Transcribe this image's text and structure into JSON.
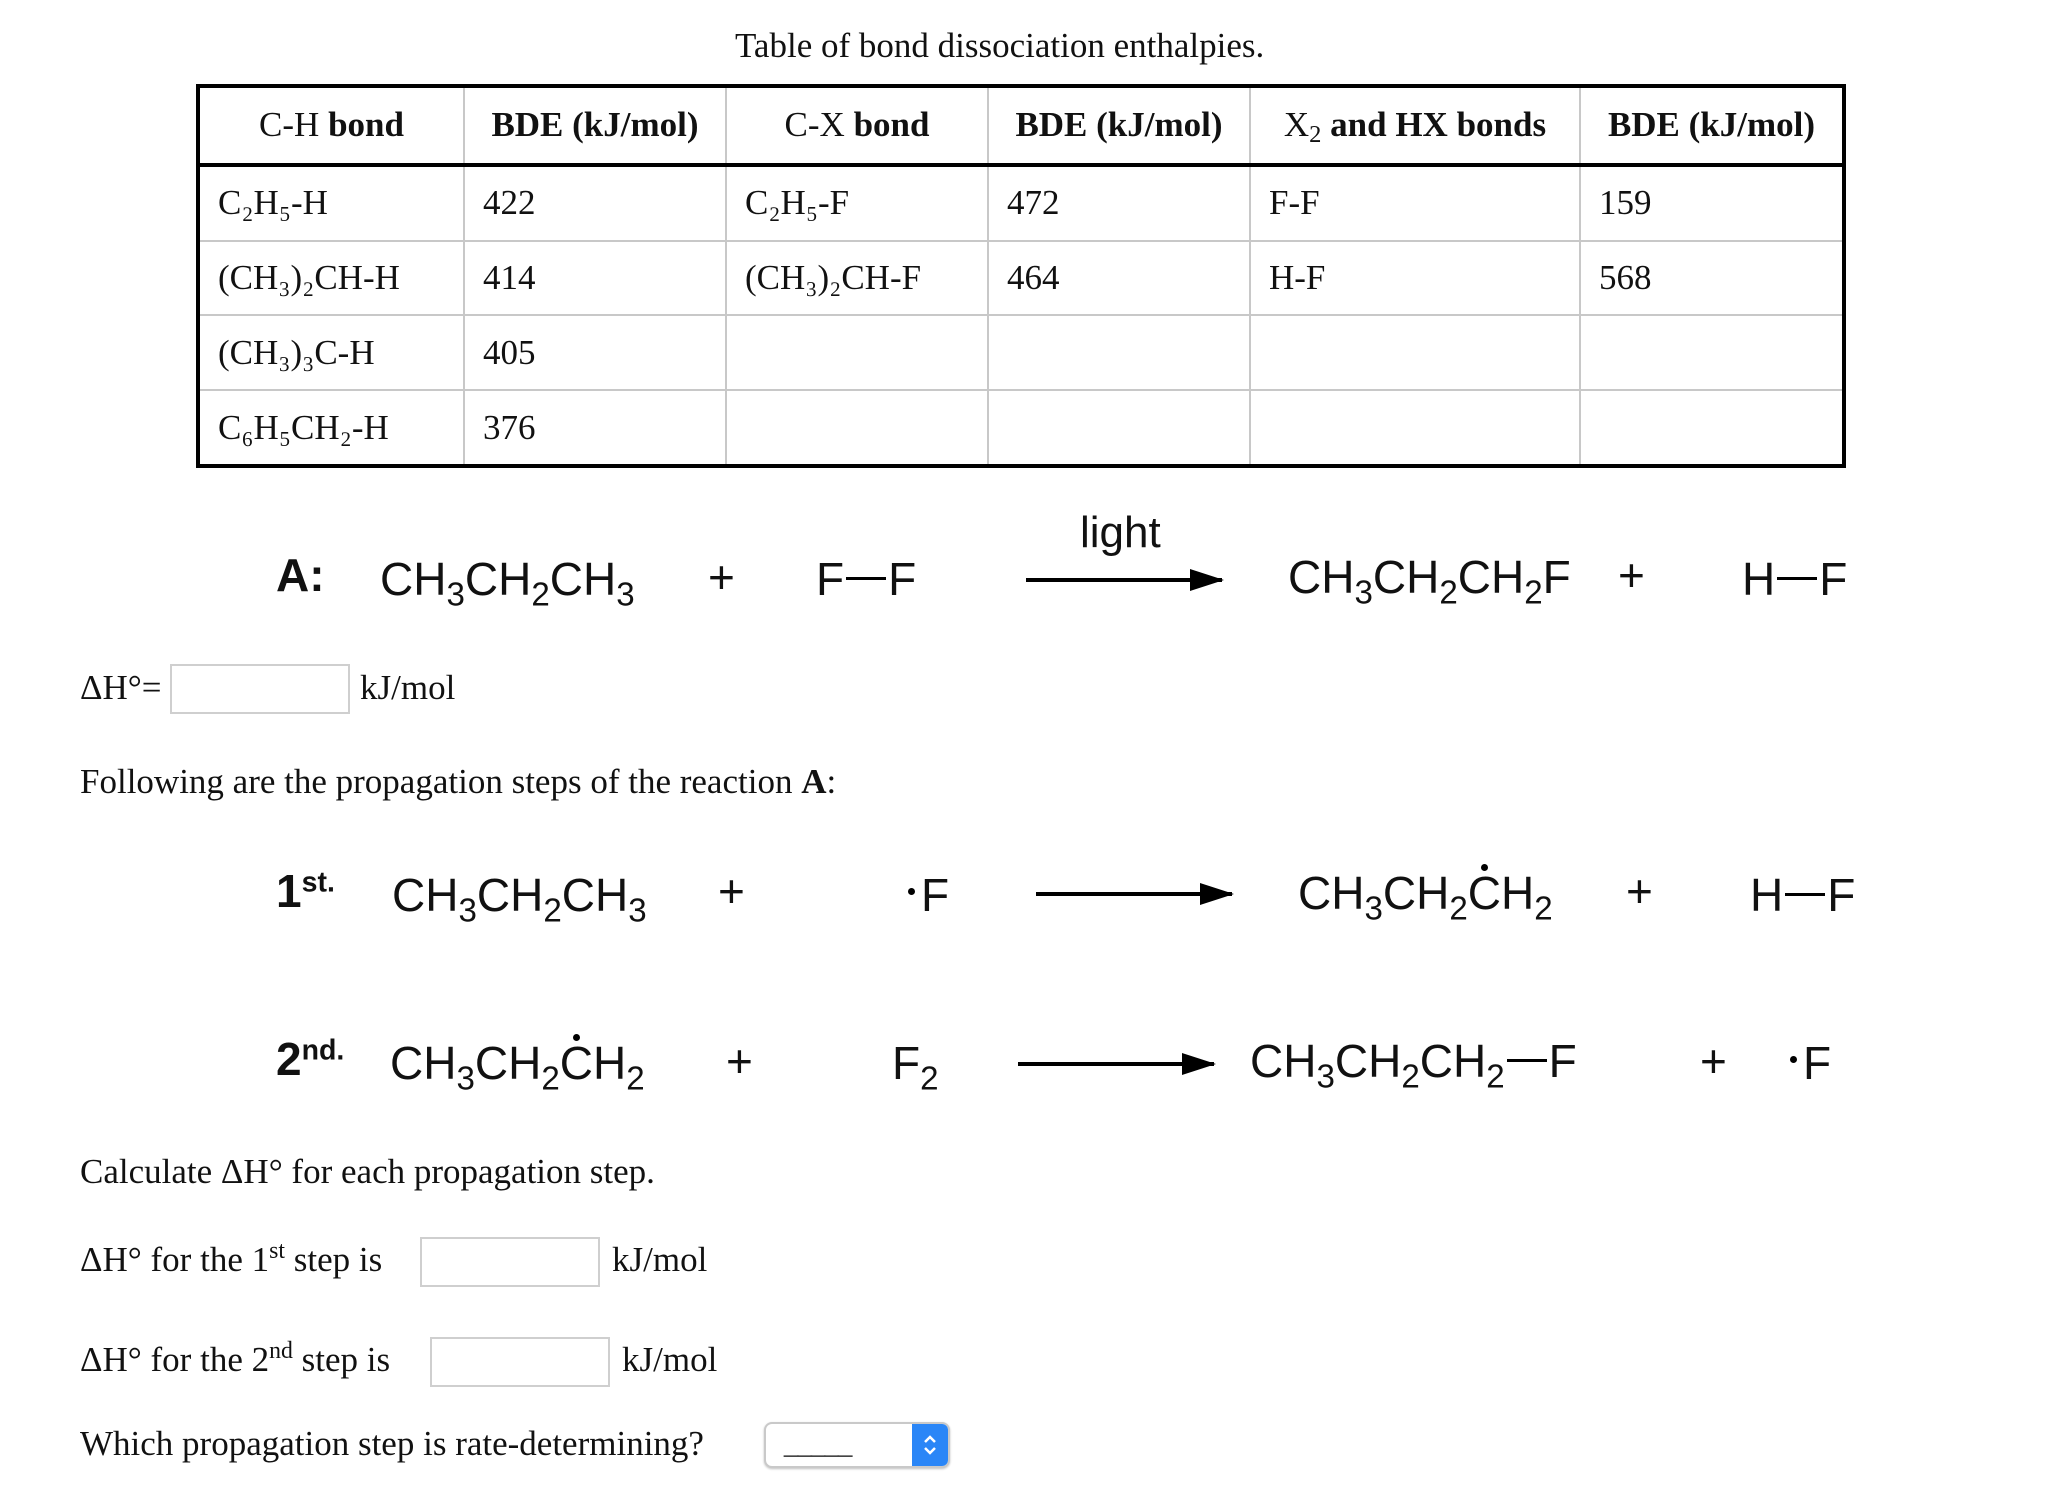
{
  "table": {
    "caption": "Table of bond dissociation enthalpies.",
    "headers": [
      {
        "main": "C-H",
        "rest": "bond"
      },
      {
        "main": "BDE (kJ/mol)",
        "rest": ""
      },
      {
        "main": "C-X",
        "rest": "bond"
      },
      {
        "main": "BDE (kJ/mol)",
        "rest": ""
      },
      {
        "main": "X",
        "sub": "2",
        "rest": "and HX bonds"
      },
      {
        "main": "BDE (kJ/mol)",
        "rest": ""
      }
    ],
    "rows": [
      {
        "ch_bond": "C₂H₅-H",
        "ch_bde": "422",
        "cx_bond": "C₂H₅-F",
        "cx_bde": "472",
        "x_bond": "F-F",
        "x_bde": "159"
      },
      {
        "ch_bond": "(CH₃)₂CH-H",
        "ch_bde": "414",
        "cx_bond": "(CH₃)₂CH-F",
        "cx_bde": "464",
        "x_bond": "H-F",
        "x_bde": "568"
      },
      {
        "ch_bond": "(CH₃)₃C-H",
        "ch_bde": "405",
        "cx_bond": "",
        "cx_bde": "",
        "x_bond": "",
        "x_bde": ""
      },
      {
        "ch_bond": "C₆H₅CH₂-H",
        "ch_bde": "376",
        "cx_bond": "",
        "cx_bde": "",
        "x_bond": "",
        "x_bde": ""
      }
    ]
  },
  "reaction_a": {
    "label": "A:",
    "reactant1": "CH3CH2CH3",
    "plus": "+",
    "reactant2": "F—F",
    "condition": "light",
    "product1": "CH3CH2CH2F",
    "product2": "H—F"
  },
  "delta_h_overall": {
    "label": "ΔH°=",
    "value": "",
    "unit": "kJ/mol"
  },
  "propagation_intro": {
    "text": "Following are the propagation steps of the reaction ",
    "bold": "A",
    "end": ":"
  },
  "step1": {
    "num": "1",
    "sup": "st.",
    "colon": ":",
    "reactant1": "CH3CH2CH3",
    "plus": "+",
    "reactant2": "•F",
    "product1": "CH3CH2ĊH2",
    "product2": "H—F"
  },
  "step2": {
    "num": "2",
    "sup": "nd.",
    "colon": ":",
    "reactant1": "CH3CH2ĊH2",
    "plus": "+",
    "reactant2": "F2",
    "product1": "CH3CH2CH2—F",
    "product2": "•F"
  },
  "calc_prompt": "Calculate ΔH° for each propagation step.",
  "step1_answer": {
    "prefix": "ΔH° for the 1",
    "sup": "st",
    "suffix": " step is",
    "value": "",
    "unit": "kJ/mol"
  },
  "step2_answer": {
    "prefix": "ΔH° for the 2",
    "sup": "nd",
    "suffix": " step is",
    "value": "",
    "unit": "kJ/mol"
  },
  "rate_question": {
    "text": "Which propagation step is rate-determining?",
    "selected": "_____"
  },
  "colors": {
    "select_accent": "#2a86f7",
    "input_border": "#cfcfcf",
    "table_inner_border": "#c8c8c8"
  }
}
